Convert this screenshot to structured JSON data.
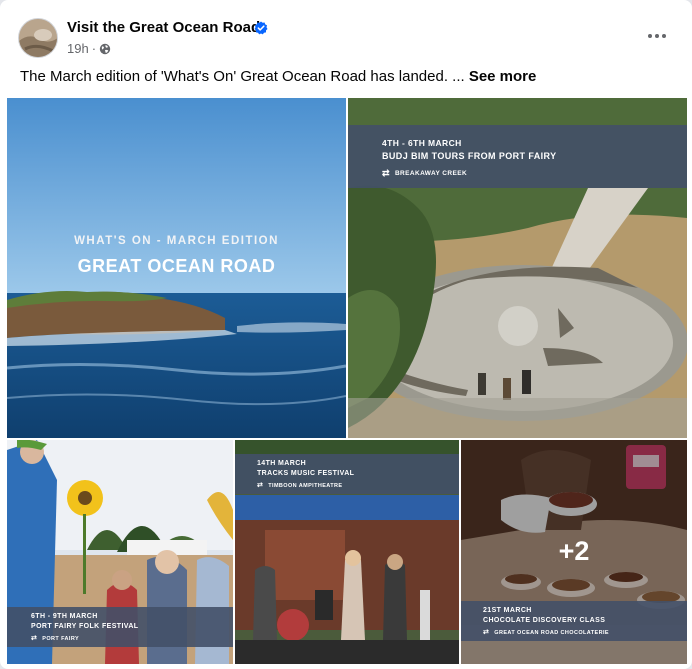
{
  "post": {
    "page_name": "Visit the Great Ocean Road",
    "timestamp": "19h",
    "separator": "·",
    "caption": "The March edition of 'What's On' Great Ocean Road has landed. ...",
    "see_more": "See more",
    "privacy_icon": "globe-icon",
    "verified_icon": "verified-badge-icon",
    "more_icon": "more-options-icon"
  },
  "photos": {
    "hero": {
      "subtitle": "WHAT'S ON - MARCH EDITION",
      "title": "GREAT OCEAN ROAD"
    },
    "budj_bim": {
      "date": "4TH - 6TH MARCH",
      "title": "BUDJ BIM TOURS FROM PORT FAIRY",
      "venue": "BREAKAWAY CREEK"
    },
    "folk_festival": {
      "date": "6TH - 9TH MARCH",
      "title": "PORT FAIRY FOLK FESTIVAL",
      "venue": "PORT FAIRY"
    },
    "tracks_music": {
      "date": "14TH MARCH",
      "title": "TRACKS MUSIC FESTIVAL",
      "venue": "TIMBOON AMPITHEATRE"
    },
    "chocolate": {
      "date": "21ST MARCH",
      "title": "CHOCOLATE DISCOVERY CLASS",
      "venue": "GREAT OCEAN ROAD CHOCOLATERIE",
      "more_count": "+2"
    }
  },
  "colors": {
    "banner": "#425068",
    "verified": "#0866ff",
    "secondary_text": "#65676b"
  }
}
